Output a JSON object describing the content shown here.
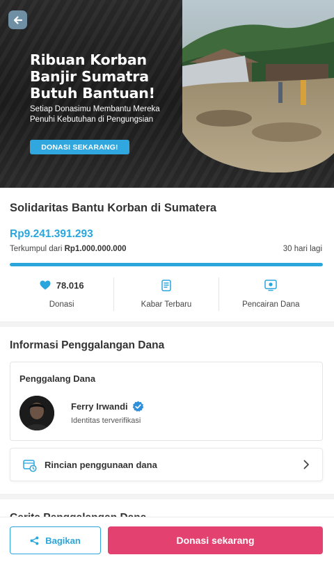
{
  "banner": {
    "headline": "Ribuan Korban Banjir Sumatra Butuh Bantuan!",
    "subhead": "Setiap Donasimu Membantu Mereka Penuhi Kebutuhan di Pengungsian",
    "cta_label": "DONASI SEKARANG!",
    "back_icon": "arrow-left-icon"
  },
  "campaign": {
    "title": "Solidaritas Bantu Korban di Sumatera",
    "amount": "Rp9.241.391.293",
    "raised_prefix": "Terkumpul dari ",
    "target": "Rp1.000.000.000",
    "days_left": "30 hari lagi",
    "progress_fraction": 1.0
  },
  "stats": {
    "donations_count": "78.016",
    "donations_label": "Donasi",
    "updates_label": "Kabar Terbaru",
    "withdrawal_label": "Pencairan Dana",
    "heart_icon": "heart-icon",
    "news_icon": "news-icon",
    "withdrawal_icon": "money-icon"
  },
  "info": {
    "title": "Informasi Penggalangan Dana",
    "fundraiser_label": "Penggalang Dana",
    "fundraiser_name": "Ferry Irwandi",
    "fundraiser_status": "Identitas terverifikasi",
    "details_label": "Rincian penggunaan dana",
    "verified_icon": "verified-badge-icon"
  },
  "next_section_peek": "Cerita Penggalangan Dana",
  "actions": {
    "share_label": "Bagikan",
    "donate_label": "Donasi sekarang"
  },
  "colors": {
    "accent": "#2aa6dd",
    "donate": "#e34271",
    "verified": "#2f8fd9"
  }
}
